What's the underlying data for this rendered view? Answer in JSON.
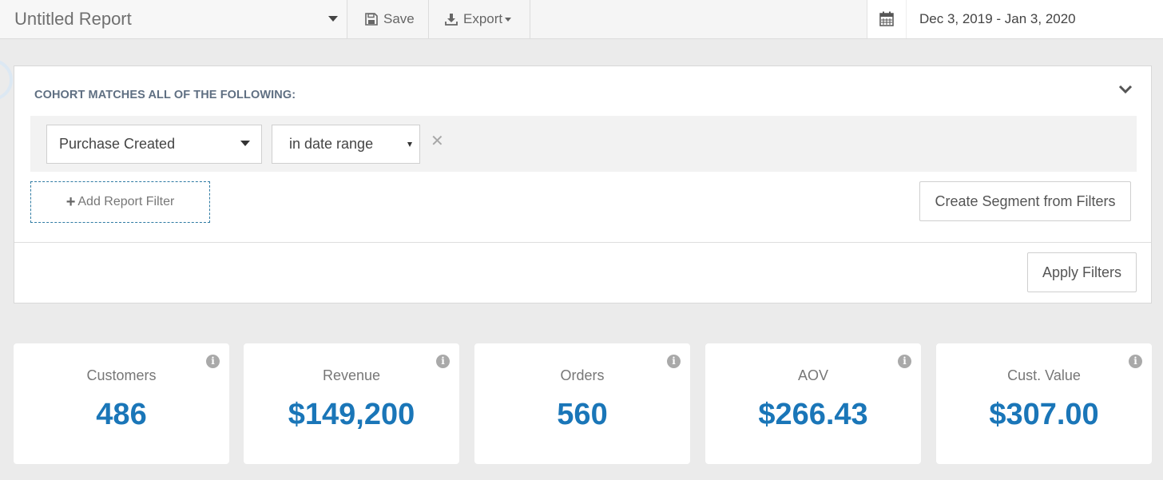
{
  "header": {
    "report_title": "Untitled Report",
    "save_label": "Save",
    "export_label": "Export",
    "date_range": "Dec 3, 2019 - Jan 3, 2020"
  },
  "filters": {
    "heading": "COHORT MATCHES ALL OF THE FOLLOWING:",
    "event_select": "Purchase Created",
    "operator_select": "in date range",
    "remove_symbol": "✕",
    "add_filter_label": "Add Report Filter",
    "create_segment_label": "Create Segment from Filters",
    "apply_label": "Apply Filters"
  },
  "metrics": [
    {
      "label": "Customers",
      "value": "486"
    },
    {
      "label": "Revenue",
      "value": "$149,200"
    },
    {
      "label": "Orders",
      "value": "560"
    },
    {
      "label": "AOV",
      "value": "$266.43"
    },
    {
      "label": "Cust. Value",
      "value": "$307.00"
    }
  ],
  "icons": {
    "info": "i"
  },
  "colors": {
    "accent": "#1a76b8",
    "heading": "#5f6f82",
    "background": "#ebebeb"
  }
}
